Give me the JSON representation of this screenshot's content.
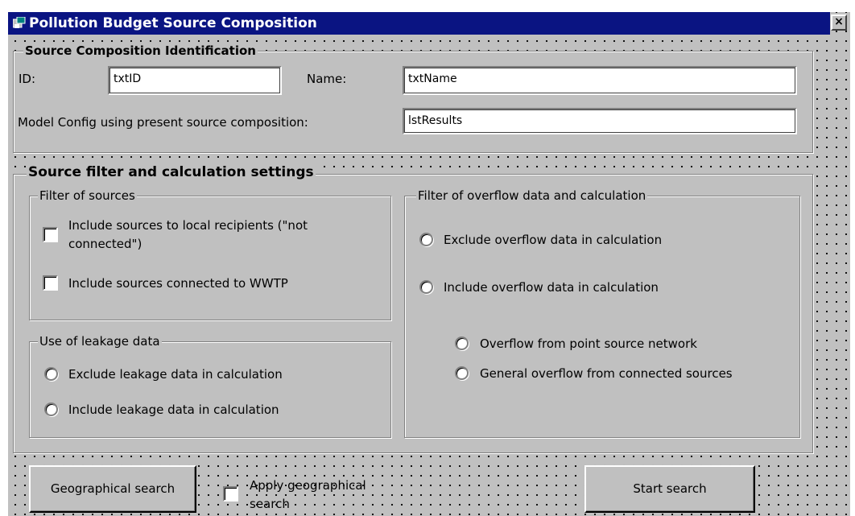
{
  "window": {
    "title": "Pollution Budget Source Composition",
    "close_glyph": "×"
  },
  "identification": {
    "legend": "Source Composition Identification",
    "id_label": "ID:",
    "id_value": "txtID",
    "name_label": "Name:",
    "name_value": "txtName",
    "model_label": "Model Config using present source composition:",
    "model_value": "lstResults"
  },
  "settings": {
    "legend": "Source filter and calculation settings",
    "filter_sources": {
      "legend": "Filter of sources",
      "local_line1": "Include sources to local recipients (\"not",
      "local_line2": "connected\")",
      "local_checked": false,
      "wwtp_label": "Include sources connected to WWTP",
      "wwtp_checked": false
    },
    "leakage": {
      "legend": "Use of leakage data",
      "exclude_label": "Exclude leakage data in calculation",
      "include_label": "Include leakage data in calculation"
    },
    "overflow": {
      "legend": "Filter of overflow data and calculation",
      "exclude_label": "Exclude overflow data in calculation",
      "include_label": "Include overflow data in calculation",
      "point_source_label": "Overflow from point source network",
      "general_label": "General overflow from connected sources"
    }
  },
  "footer": {
    "geo_search_button": "Geographical search",
    "apply_geo_line1": "Apply geographical",
    "apply_geo_line2": "search",
    "apply_geo_checked": false,
    "start_search_button": "Start search"
  },
  "colors": {
    "titlebar": "#0a1482",
    "face": "#c0c0c0",
    "grid_dots": "#000000"
  }
}
